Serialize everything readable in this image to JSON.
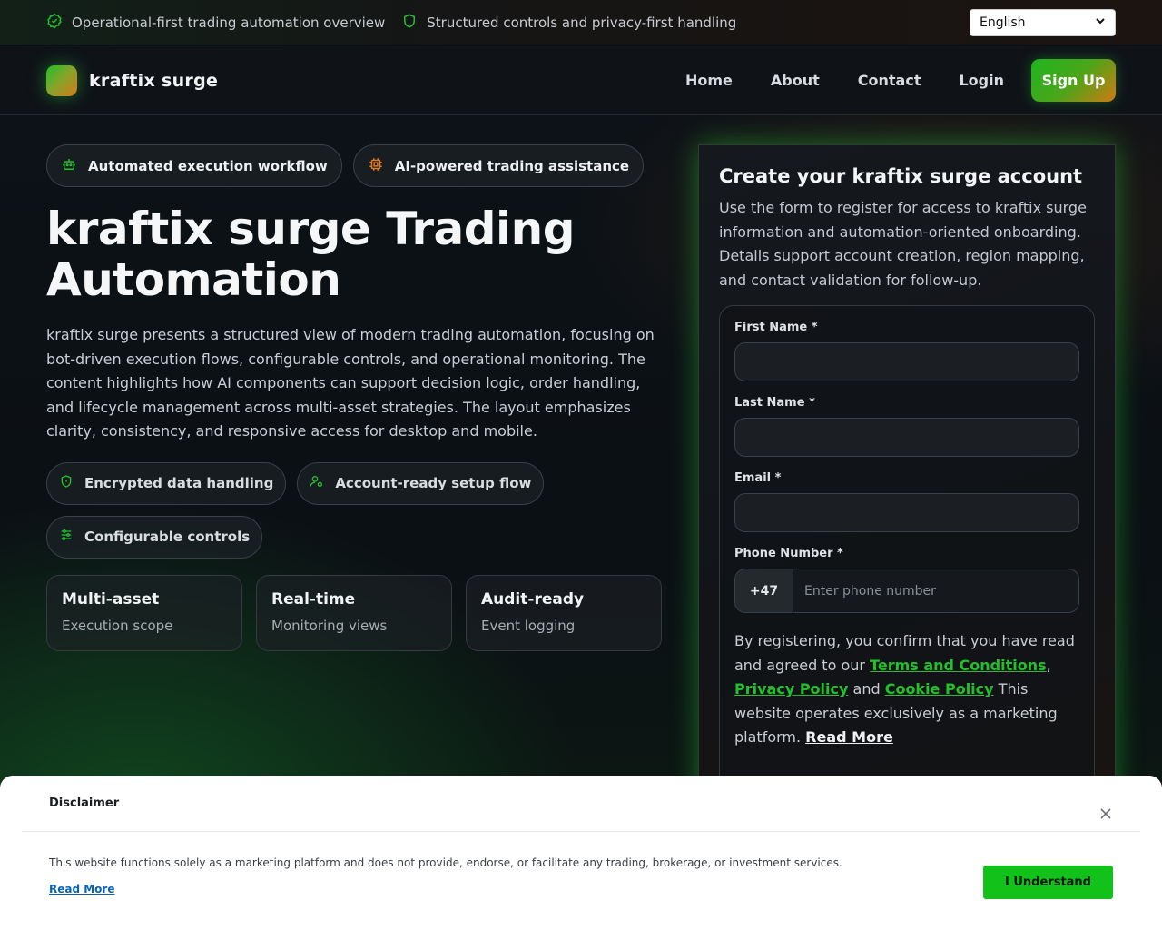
{
  "topbar": {
    "item1": "Operational-first trading automation overview",
    "item2": "Structured controls and privacy-first handling",
    "language": "English"
  },
  "nav": {
    "brand": "kraftix surge",
    "links": [
      "Home",
      "About",
      "Contact",
      "Login"
    ],
    "signup": "Sign Up"
  },
  "hero": {
    "badges": [
      "Automated execution workflow",
      "AI-powered trading assistance"
    ],
    "title": "kraftix surge Trading Automation",
    "description": "kraftix surge presents a structured view of modern trading automation, focusing on bot-driven execution flows, configurable controls, and operational monitoring. The content highlights how AI components can support decision logic, order handling, and lifecycle management across multi-asset strategies. The layout emphasizes clarity, consistency, and responsive access for desktop and mobile.",
    "features": [
      "Encrypted data handling",
      "Account-ready setup flow",
      "Configurable controls"
    ],
    "stats": [
      {
        "title": "Multi-asset",
        "sub": "Execution scope"
      },
      {
        "title": "Real-time",
        "sub": "Monitoring views"
      },
      {
        "title": "Audit-ready",
        "sub": "Event logging"
      }
    ]
  },
  "form": {
    "heading": "Create your kraftix surge account",
    "intro": "Use the form to register for access to kraftix surge information and automation-oriented onboarding. Details support account creation, region mapping, and contact validation for follow-up.",
    "first_name_label": "First Name *",
    "last_name_label": "Last Name *",
    "email_label": "Email *",
    "phone_label": "Phone Number *",
    "country_code": "+47",
    "phone_placeholder": "Enter phone number",
    "consent_start": "By registering, you confirm that you have read and agreed to our ",
    "terms": "Terms and Conditions",
    "comma": ",",
    "privacy": "Privacy Policy",
    "and": " and ",
    "cookie": "Cookie Policy",
    "consent_end": " This website operates exclusively as a marketing platform. ",
    "read_more": "Read More"
  },
  "disclaimer": {
    "title": "Disclaimer",
    "message": "This website functions solely as a marketing platform and does not provide, endorse, or facilitate any trading, brokerage, or investment services.",
    "read_more": "Read More",
    "button": "I Understand"
  },
  "colors": {
    "accent_green": "#22c02a",
    "accent_orange": "#d47a1a",
    "link_blue": "#0b63b6"
  }
}
